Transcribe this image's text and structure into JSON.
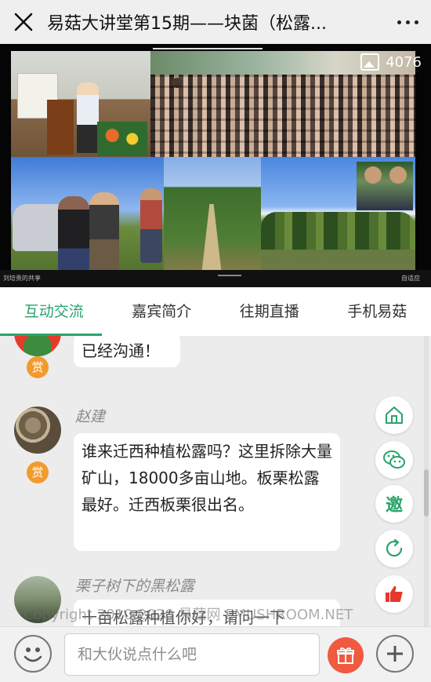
{
  "header": {
    "title": "易菇大讲堂第15期——块菌（松露...",
    "close_icon": "close-icon",
    "more_icon": "more-dots-icon"
  },
  "video": {
    "view_count": "4076",
    "presenter_label": "刘培贵的共享",
    "window_label": "自适应"
  },
  "tabs": [
    {
      "label": "互动交流",
      "active": true
    },
    {
      "label": "嘉宾简介",
      "active": false
    },
    {
      "label": "往期直播",
      "active": false
    },
    {
      "label": "手机易菇",
      "active": false
    }
  ],
  "chat": {
    "reward_label": "赏",
    "messages": [
      {
        "user": "",
        "text": "已经沟通！"
      },
      {
        "user": "赵建",
        "text": "谁来迁西种植松露吗？这里拆除大量矿山，18000多亩山地。板栗松露最好。迁西板栗很出名。"
      },
      {
        "user": "栗子树下的黑松露",
        "text": "十亩松露种植你好，请问一下"
      }
    ],
    "watermark": "Copyright 2010-2020 易菇网 EMUSHROOM.NET"
  },
  "fabs": {
    "invite_label": "邀"
  },
  "input": {
    "placeholder": "和大伙说点什么吧"
  },
  "colors": {
    "accent": "#2aa36b",
    "reward": "#f39a2c",
    "gift": "#f05a3f",
    "like": "#e8372c"
  }
}
